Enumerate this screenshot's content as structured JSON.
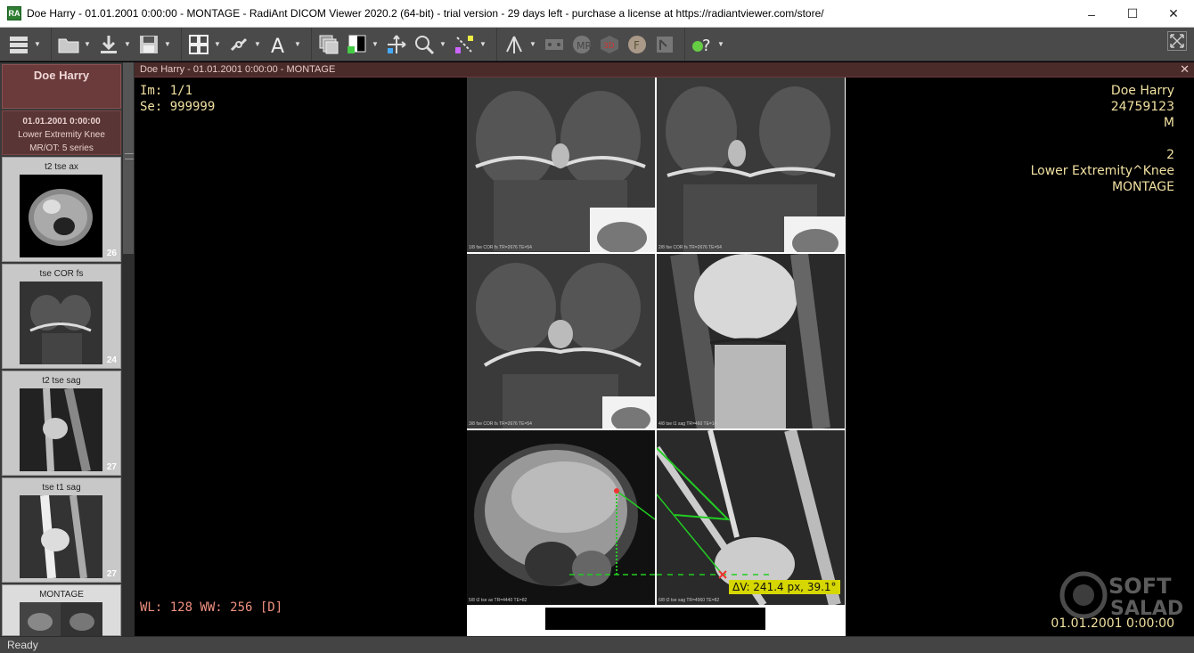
{
  "window": {
    "title": "Doe Harry - 01.01.2001 0:00:00 - MONTAGE - RadiAnt DICOM Viewer 2020.2 (64-bit) - trial version - 29 days left - purchase a license at https://radiantviewer.com/store/",
    "app_icon_text": "RA",
    "minimize": "–",
    "maximize": "☐",
    "close": "✕"
  },
  "toolbar": {
    "icons": [
      "menu-icon",
      "open-folder-icon",
      "download-icon",
      "save-icon",
      "layout-grid-icon",
      "link-icon",
      "text-annotation-icon",
      "series-stack-icon",
      "window-level-icon",
      "pan-icon",
      "zoom-icon",
      "measure-icon",
      "3d-cursor-icon",
      "cine-icon",
      "mpr-icon",
      "3d-icon",
      "fusion-icon",
      "flip-icon",
      "help-icon",
      "fullscreen-icon"
    ]
  },
  "sidebar": {
    "patient_name": "Doe Harry",
    "study": {
      "date": "01.01.2001 0:00:00",
      "description": "Lower Extremity Knee",
      "modality": "MR/OT: 5 series"
    },
    "series": [
      {
        "label": "t2 tse ax",
        "count": "26"
      },
      {
        "label": "tse COR  fs",
        "count": "24"
      },
      {
        "label": "t2 tse sag",
        "count": "27"
      },
      {
        "label": "tse t1 sag",
        "count": "27"
      },
      {
        "label": "MONTAGE",
        "count": ""
      }
    ]
  },
  "viewport": {
    "header_title": "Doe Harry - 01.01.2001 0:00:00 - MONTAGE",
    "close": "✕",
    "overlay_left": {
      "im": "Im: 1/1",
      "se": "Se: 999999"
    },
    "overlay_right": {
      "name": "Doe Harry",
      "id": "24759123",
      "sex": "M",
      "blank": "",
      "series_no": "2",
      "body_part": "Lower Extremity^Knee",
      "series_desc": "MONTAGE"
    },
    "wl": "WL: 128 WW: 256 [D]",
    "date": "01.01.2001 0:00:00",
    "measurement": "ΔV: 241.4 px, 39.1°",
    "cell_labels": [
      "1/8 fse COR fs TR=2676 TE=54",
      "2/8 fse COR fs TR=2676 TE=54",
      "3/8 fse COR fs TR=2676 TE=54",
      "4/8 tse t1 sag TR=460 TE=14",
      "5/8 t2 tse ax TR=4440 TE=82",
      "6/8 t2 tse sag TR=4960 TE=82"
    ]
  },
  "status": {
    "text": "Ready"
  },
  "watermark": {
    "line1": "SOFT",
    "line2": "SALAD"
  }
}
